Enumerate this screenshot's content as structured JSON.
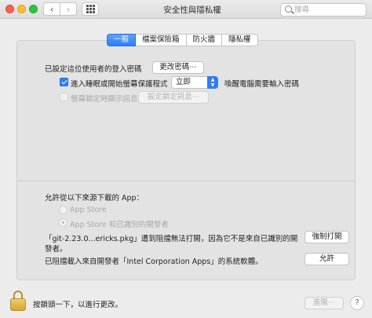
{
  "window": {
    "title": "安全性與隱私權",
    "search_placeholder": "搜尋",
    "back": "‹",
    "forward": "›"
  },
  "tabs": [
    {
      "label": "一般",
      "active": true
    },
    {
      "label": "檔案保險箱",
      "active": false
    },
    {
      "label": "防火牆",
      "active": false
    },
    {
      "label": "隱私權",
      "active": false
    }
  ],
  "general": {
    "password_set_label": "已設定這位使用者的登入密碼",
    "change_password_button": "更改密碼⋯",
    "require_password_label": "進入睡眠或開始螢幕保護程式",
    "require_password_checked": true,
    "require_password_value": "立即",
    "require_password_suffix": "喚醒電腦需要輸入密碼",
    "show_message_label": "螢幕鎖定時顯示訊息",
    "show_message_checked": false,
    "set_lock_message_button": "設定鎖定訊息⋯"
  },
  "downloads": {
    "heading": "允許從以下來源下載的 App：",
    "options": [
      {
        "label": "App Store",
        "selected": false
      },
      {
        "label": "App Store 和已識別的開發者",
        "selected": true
      }
    ],
    "blocked_line1": "「git-2.23.0...ericks.pkg」遭到阻擋無法打開，因為它不是來自已識別的開",
    "blocked_line2": "發者。",
    "open_anyway_button": "強制打開",
    "blocked_dev_label": "已阻擋載入來自開發者「Intel Corporation Apps」的系統軟體。",
    "allow_button": "允許"
  },
  "footer": {
    "lock_label": "按鎖頭一下，以進行更改。",
    "advanced_button": "進階⋯",
    "help": "?"
  },
  "colors": {
    "accent": "#2f7cf6",
    "lock": "#d3a53b"
  }
}
